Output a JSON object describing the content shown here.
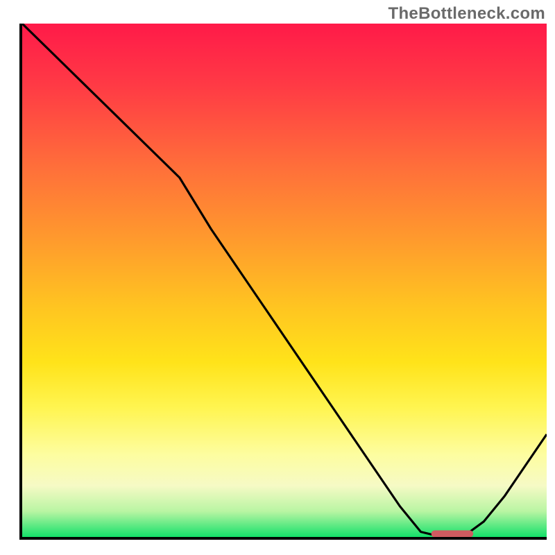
{
  "watermark": "TheBottleneck.com",
  "chart_data": {
    "type": "line",
    "title": "",
    "xlabel": "",
    "ylabel": "",
    "xlim": [
      0,
      100
    ],
    "ylim": [
      0,
      100
    ],
    "x": [
      0,
      6,
      12,
      18,
      24,
      30,
      36,
      42,
      48,
      54,
      60,
      66,
      72,
      76,
      80,
      84,
      88,
      92,
      96,
      100
    ],
    "values": [
      100,
      94,
      88,
      82,
      76,
      70,
      60,
      51,
      42,
      33,
      24,
      15,
      6,
      1,
      0,
      0,
      3,
      8,
      14,
      20
    ],
    "marker": {
      "x_start": 78,
      "x_end": 86,
      "y": 0.6
    },
    "gradient_stops": [
      {
        "pos": 0,
        "color": "#ff1a49"
      },
      {
        "pos": 12,
        "color": "#ff3a45"
      },
      {
        "pos": 28,
        "color": "#ff6f3a"
      },
      {
        "pos": 42,
        "color": "#ff9a2d"
      },
      {
        "pos": 55,
        "color": "#ffc421"
      },
      {
        "pos": 66,
        "color": "#ffe31a"
      },
      {
        "pos": 75,
        "color": "#fff552"
      },
      {
        "pos": 84,
        "color": "#fdfda0"
      },
      {
        "pos": 90,
        "color": "#f6fac5"
      },
      {
        "pos": 95,
        "color": "#b9f5a3"
      },
      {
        "pos": 100,
        "color": "#14e06a"
      }
    ]
  }
}
